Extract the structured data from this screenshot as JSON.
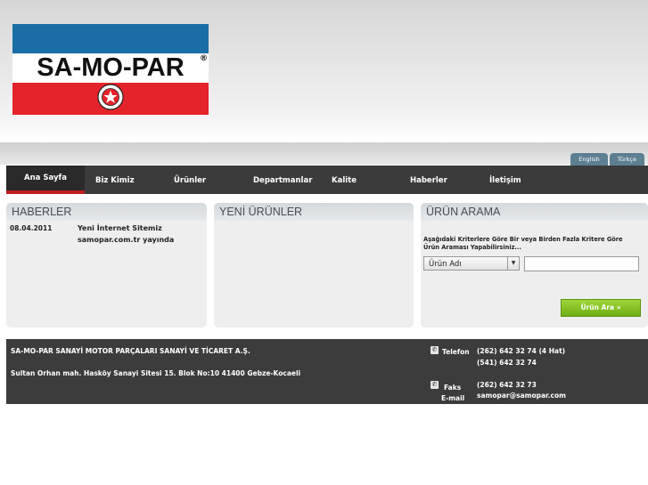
{
  "brand": {
    "name": "SA-MO-PAR",
    "reg": "®",
    "colors": {
      "blue": "#1a6ea5",
      "red": "#e5232b",
      "green": "#7fbf22",
      "nav": "#3b3b3b"
    }
  },
  "langs": [
    "English",
    "Türkçe"
  ],
  "nav": [
    "Ana Sayfa",
    "Biz Kimiz",
    "Ürünler",
    "Departmanlar",
    "Kalite",
    "Haberler",
    "İletişim"
  ],
  "panels": {
    "news": {
      "title": "HABERLER",
      "date": "08.04.2011",
      "text1": "Yeni İnternet Sitemiz",
      "text2": "samopar.com.tr yayında"
    },
    "new_products": {
      "title": "YENİ ÜRÜNLER"
    },
    "search": {
      "title": "ÜRÜN ARAMA",
      "hint": "Aşağıdaki Kriterlere Göre Bir veya Birden Fazla Kritere Göre Ürün Araması Yapabilirsiniz...",
      "select_value": "Ürün Adı",
      "button": "Ürün Ara »"
    }
  },
  "footer": {
    "company": "SA-MO-PAR SANAYİ MOTOR PARÇALARI SANAYİ VE TİCARET A.Ş.",
    "address": "Sultan Orhan mah. Hasköy Sanayi Sitesi 15. Blok No:10 41400  Gebze-Kocaeli",
    "phone_label": "Telefon",
    "phone1": "(262) 642 32 74 (4 Hat)",
    "phone2": "(541) 642 32 74",
    "fax_label": "Faks",
    "fax": "(262) 642 32 73",
    "email_label": "E-mail",
    "email": "samopar@samopar.com"
  }
}
